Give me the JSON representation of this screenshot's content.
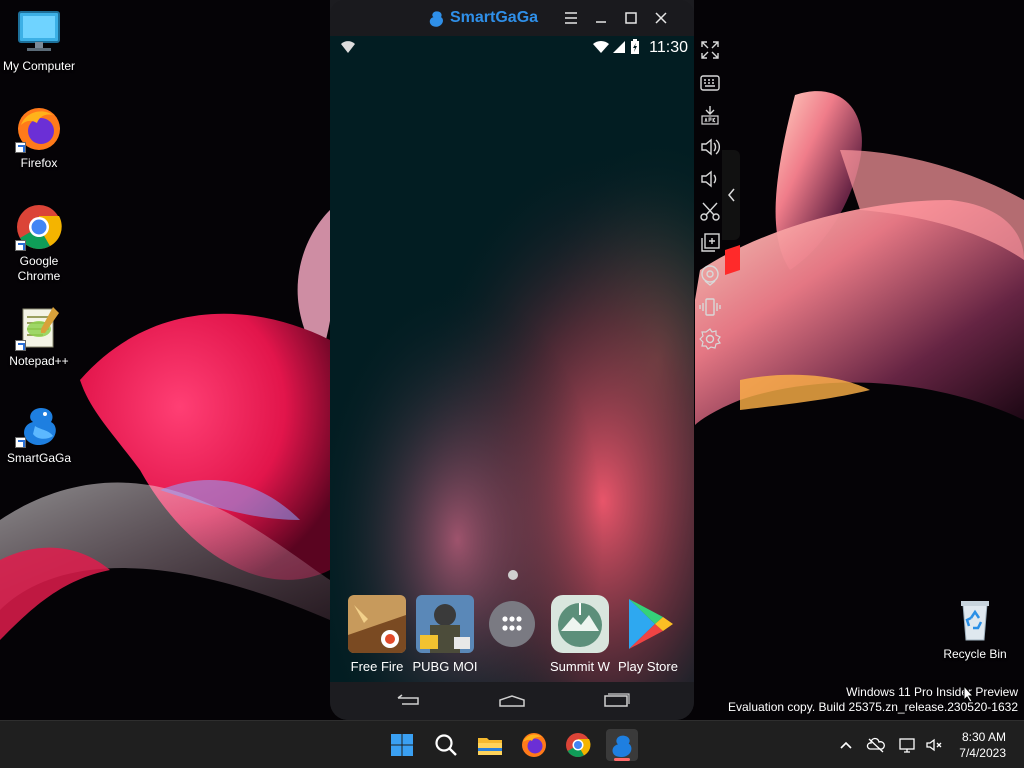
{
  "desktop": {
    "icons": [
      {
        "label": "My Computer",
        "icon": "monitor-icon"
      },
      {
        "label": "Firefox",
        "icon": "firefox-icon"
      },
      {
        "label": "Google Chrome",
        "icon": "chrome-icon"
      },
      {
        "label": "Notepad++",
        "icon": "notepad-plus-plus-icon"
      },
      {
        "label": "SmartGaGa",
        "icon": "smartgaga-icon"
      },
      {
        "label": "Recycle Bin",
        "icon": "recycle-bin-icon"
      }
    ]
  },
  "emulator": {
    "title": "SmartGaGa",
    "status_bar": {
      "time": "11:30"
    },
    "home_apps": [
      {
        "label": "Free Fire",
        "icon": "free-fire-icon"
      },
      {
        "label": "PUBG MOI",
        "icon": "pubg-icon"
      },
      {
        "label": "",
        "icon": "app-drawer-icon"
      },
      {
        "label": "Summit W",
        "icon": "summit-icon"
      },
      {
        "label": "Play Store",
        "icon": "play-store-icon"
      }
    ],
    "toolbar": [
      "fullscreen-icon",
      "keyboard-icon",
      "apk-install-icon",
      "volume-up-icon",
      "volume-down-icon",
      "screenshot-icon",
      "multi-instance-icon",
      "location-icon",
      "shake-icon",
      "settings-icon"
    ]
  },
  "watermark": {
    "line1": "Windows 11 Pro Insider Preview",
    "line2": "Evaluation copy. Build 25375.zn_release.230520-1632"
  },
  "taskbar": {
    "apps": [
      "start-icon",
      "search-icon",
      "file-explorer-icon",
      "firefox-icon",
      "chrome-icon",
      "smartgaga-icon"
    ],
    "time": "8:30 AM",
    "date": "7/4/2023"
  },
  "colors": {
    "accent": "#2f8fe8",
    "taskbar_bg": "#1f1f1f"
  }
}
